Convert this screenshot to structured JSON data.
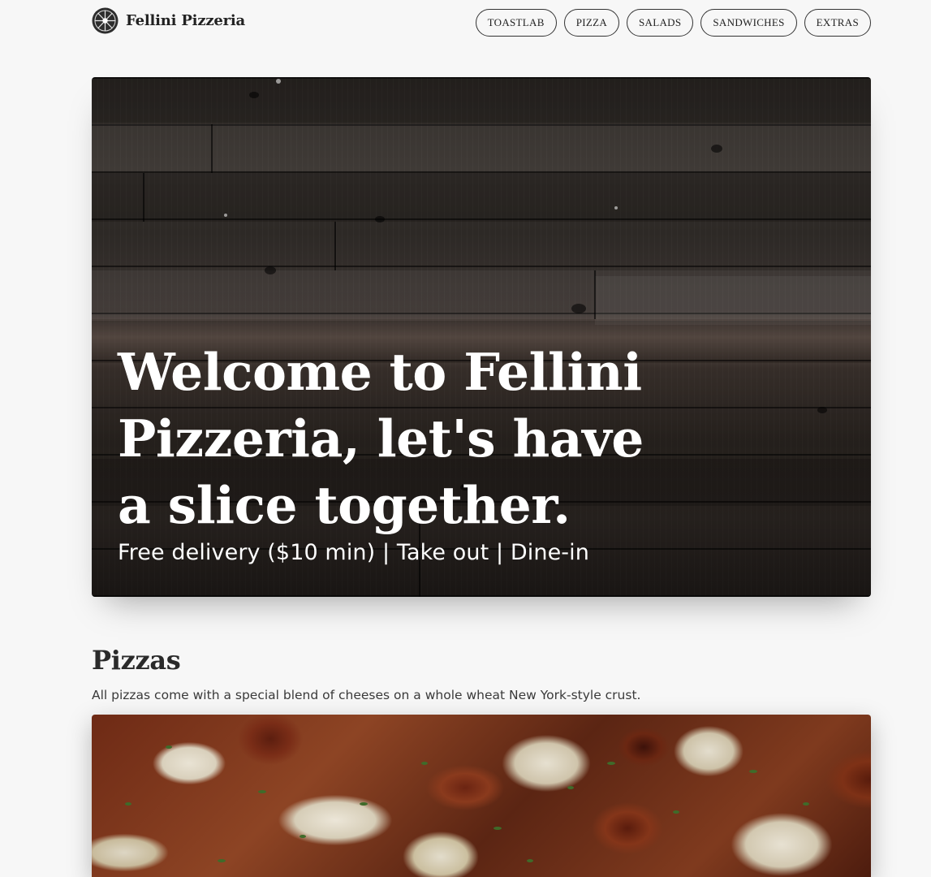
{
  "header": {
    "brand_name": "Fellini Pizzeria",
    "logo_icon": "pizzeria-logo-icon"
  },
  "nav": {
    "items": [
      {
        "label": "TOASTLAB"
      },
      {
        "label": "PIZZA"
      },
      {
        "label": "SALADS"
      },
      {
        "label": "SANDWICHES"
      },
      {
        "label": "EXTRAS"
      }
    ]
  },
  "hero": {
    "title": "Welcome to Fellini Pizzeria, let's have a slice together.",
    "subtitle": "Free delivery ($10 min) | Take out | Dine-in"
  },
  "pizzas_section": {
    "title": "Pizzas",
    "description": "All pizzas come with a special blend of cheeses on a whole wheat New York-style crust."
  },
  "colors": {
    "page_background": "#f7f7f7",
    "text": "#2b2b2b",
    "hero_text": "#ffffff",
    "nav_border": "#333333"
  }
}
